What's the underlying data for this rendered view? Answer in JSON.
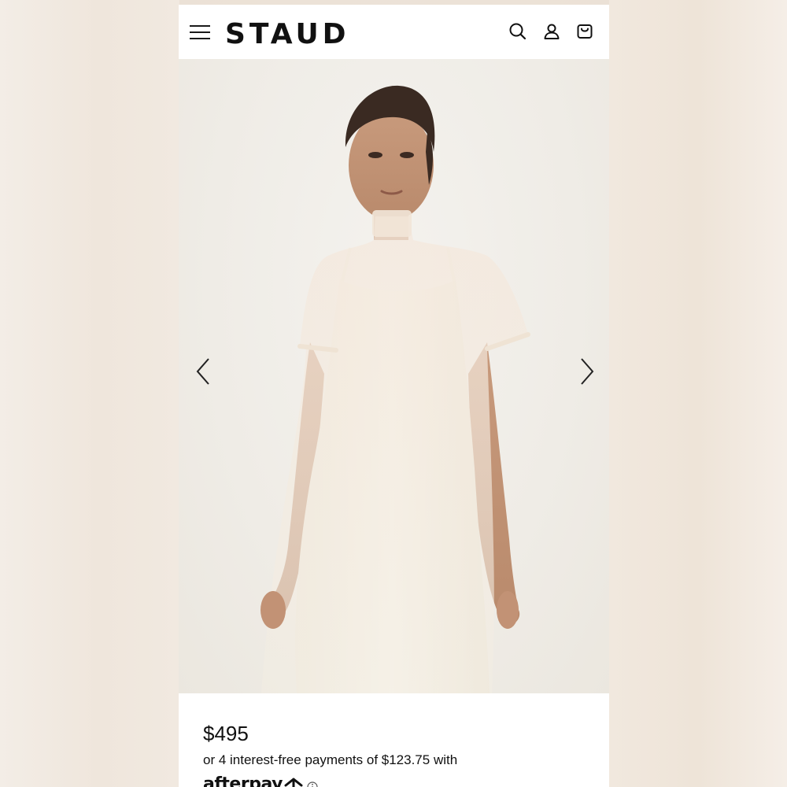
{
  "header": {
    "brand": "STAUD",
    "icons": [
      "menu-icon",
      "search-icon",
      "account-icon",
      "shopping-bag-icon"
    ]
  },
  "gallery": {
    "image_alt": "Model wearing a sheer ivory mock-neck short-sleeve dress over a white slip dress",
    "icons": [
      "chevron-left-icon",
      "chevron-right-icon"
    ]
  },
  "product": {
    "price": "$495",
    "installments_text": "or 4 interest-free payments of $123.75 with",
    "afterpay_label": "afterpay"
  },
  "colors": {
    "text": "#111111",
    "background": "#ffffff",
    "dress": "#f5f1e8"
  }
}
